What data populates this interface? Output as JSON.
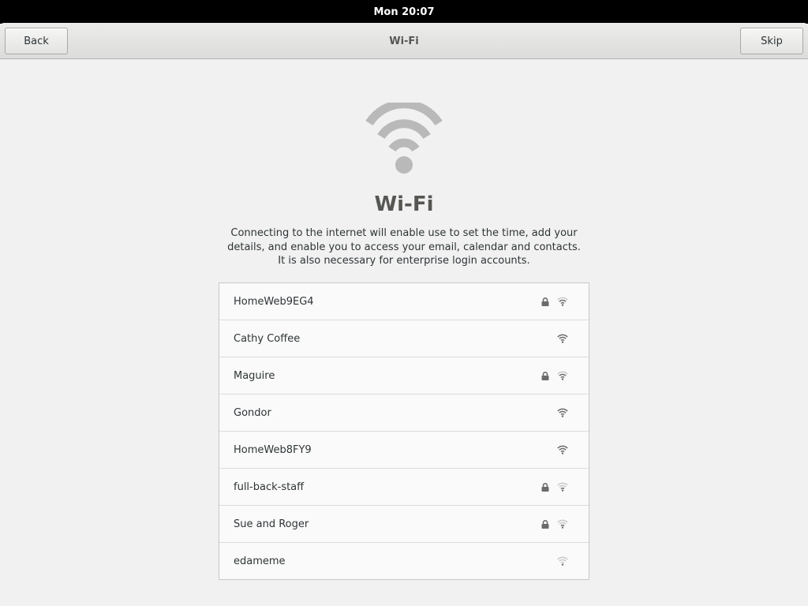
{
  "topbar": {
    "clock": "Mon 20:07"
  },
  "header": {
    "back_label": "Back",
    "title": "Wi-Fi",
    "skip_label": "Skip"
  },
  "main": {
    "icon": "wifi-icon",
    "title": "Wi-Fi",
    "description": "Connecting to the internet will enable use to set the time, add your details, and enable you to access your email, calendar and contacts. It is also necessary for enterprise login accounts."
  },
  "networks": [
    {
      "name": "HomeWeb9EG4",
      "secured": true,
      "signal": 3
    },
    {
      "name": "Cathy Coffee",
      "secured": false,
      "signal": 4
    },
    {
      "name": "Maguire",
      "secured": true,
      "signal": 3
    },
    {
      "name": "Gondor",
      "secured": false,
      "signal": 4
    },
    {
      "name": "HomeWeb8FY9",
      "secured": false,
      "signal": 4
    },
    {
      "name": "full-back-staff",
      "secured": true,
      "signal": 2
    },
    {
      "name": "Sue and Roger",
      "secured": true,
      "signal": 2
    },
    {
      "name": "edameme",
      "secured": false,
      "signal": 1
    }
  ],
  "colors": {
    "icon_active": "#6b6b6b",
    "icon_inactive": "#c9c9c9",
    "hero_icon": "#b9b9b9"
  }
}
